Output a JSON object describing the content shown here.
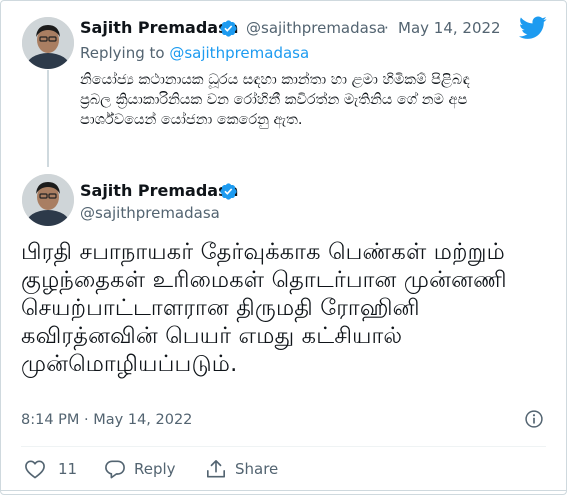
{
  "reply_tweet": {
    "author_name": "Sajith Premadasa",
    "author_handle": "@sajithpremadasa",
    "separator": "·",
    "date": "May 14, 2022",
    "replying_prefix": "Replying to ",
    "replying_handle": "@sajithpremadasa",
    "text": "නියෝජ්‍ය කථානායක ධූරය සඳහා කාන්තා හා ළමා හිමිකම් පිළිබඳ ප්‍රබල ක්‍රියාකාරිනියක වන රෝහිනී කවිරත්න මැතිනිය ගේ නම අප පාර්ශ්වයෙන් යෝජනා කෙරෙනු ඇත."
  },
  "main_tweet": {
    "author_name": "Sajith Premadasa",
    "author_handle": "@sajithpremadasa",
    "text": "பிரதி சபாநாயகர் தேர்வுக்காக பெண்கள் மற்றும் குழந்தைகள் உரிமைகள் தொடர்பான முன்னணி செயற்பாட்டாளரான திருமதி ரோஹினி கவிரத்னவின் பெயர் எமது கட்சியால் முன்மொழியப்படும்.",
    "timestamp": "8:14 PM · May 14, 2022",
    "like_count": "11",
    "reply_label": "Reply",
    "share_label": "Share"
  },
  "icons": {
    "logo": "twitter-bird-icon",
    "verified": "verified-badge-icon",
    "info": "info-icon",
    "like": "heart-icon",
    "reply": "reply-bubble-icon",
    "share": "share-icon"
  },
  "colors": {
    "accent": "#1d9bf0",
    "text": "#0f1419",
    "secondary_text": "#536471",
    "border": "#cfd9de"
  }
}
